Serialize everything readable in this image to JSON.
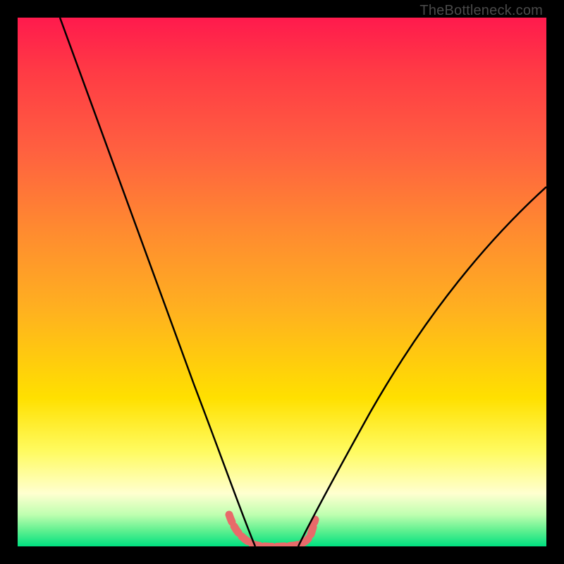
{
  "watermark": "TheBottleneck.com",
  "chart_data": {
    "type": "line",
    "title": "",
    "xlabel": "",
    "ylabel": "",
    "xlim": [
      0,
      100
    ],
    "ylim": [
      0,
      100
    ],
    "background_gradient_stops": [
      {
        "pct": 0,
        "color": "#ff1a4d"
      },
      {
        "pct": 10,
        "color": "#ff3a45"
      },
      {
        "pct": 25,
        "color": "#ff6040"
      },
      {
        "pct": 40,
        "color": "#ff8a30"
      },
      {
        "pct": 55,
        "color": "#ffb020"
      },
      {
        "pct": 72,
        "color": "#ffe000"
      },
      {
        "pct": 82,
        "color": "#fffb60"
      },
      {
        "pct": 90,
        "color": "#ffffd0"
      },
      {
        "pct": 94,
        "color": "#bfffb0"
      },
      {
        "pct": 97,
        "color": "#60f090"
      },
      {
        "pct": 100,
        "color": "#00e080"
      }
    ],
    "series": [
      {
        "name": "left-curve",
        "stroke": "#000000",
        "stroke_width": 2.5,
        "x": [
          8,
          12,
          16,
          20,
          24,
          28,
          32,
          36,
          40,
          42,
          44,
          45
        ],
        "y": [
          100,
          88,
          76,
          63,
          51,
          39,
          27,
          16,
          7,
          3,
          0.5,
          0
        ]
      },
      {
        "name": "right-curve",
        "stroke": "#000000",
        "stroke_width": 2.5,
        "x": [
          53,
          55,
          58,
          62,
          68,
          74,
          80,
          86,
          92,
          98,
          100
        ],
        "y": [
          0,
          1,
          4,
          9,
          18,
          28,
          38,
          48,
          57,
          65,
          68
        ]
      },
      {
        "name": "floor-marker",
        "stroke": "#e86a6a",
        "stroke_width": 11,
        "x": [
          40,
          41,
          43,
          45,
          47,
          49,
          51,
          53,
          55,
          56
        ],
        "y": [
          6,
          3,
          1,
          0,
          0,
          0,
          0,
          0,
          2,
          5
        ]
      }
    ]
  }
}
